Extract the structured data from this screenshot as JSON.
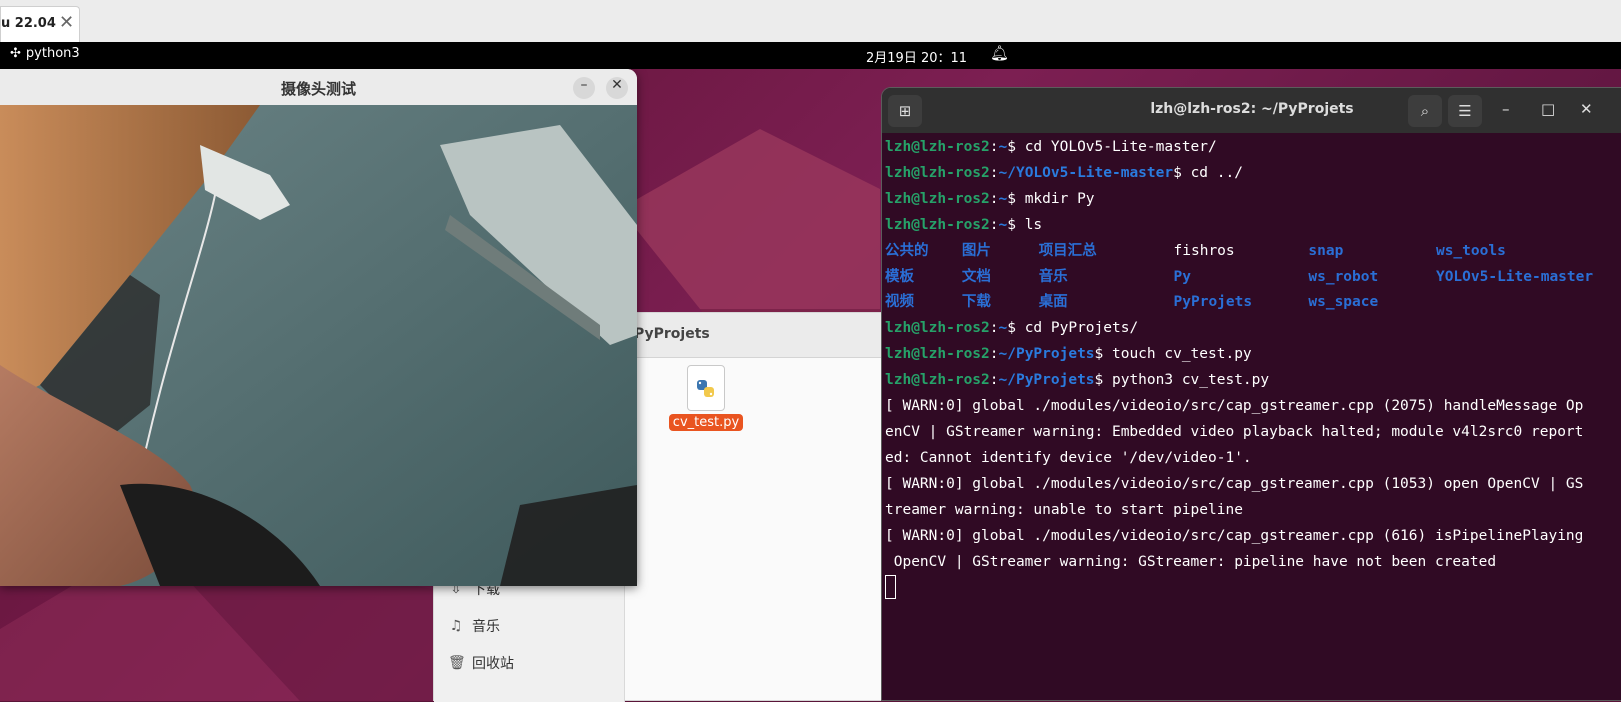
{
  "vm_tab": {
    "label": "u 22.04",
    "close": "✕"
  },
  "topbar": {
    "app_name": "python3",
    "clock": "2月19日 20：11"
  },
  "camera_window": {
    "title": "摄像头测试",
    "min": "–",
    "close": "✕"
  },
  "files_window": {
    "path": "PyProjets",
    "sidebar": [
      {
        "label": "下载",
        "icon": "download-icon"
      },
      {
        "label": "音乐",
        "icon": "music-icon"
      },
      {
        "label": "回收站",
        "icon": "trash-icon"
      }
    ],
    "files": [
      {
        "name": "cv_test.py",
        "icon": "python-file-icon"
      }
    ]
  },
  "terminal": {
    "title": "lzh@lzh-ros2: ~/PyProjets",
    "user_host": "lzh@lzh-ros2",
    "lines": [
      {
        "type": "prompt",
        "path": "~",
        "cmd": " cd YOLOv5-Lite-master/"
      },
      {
        "type": "prompt",
        "path": "~/YOLOv5-Lite-master",
        "cmd": " cd ../"
      },
      {
        "type": "prompt",
        "path": "~",
        "cmd": " mkdir Py"
      },
      {
        "type": "prompt",
        "path": "~",
        "cmd": " ls"
      },
      {
        "type": "ls",
        "cols": [
          {
            "t": "公共的",
            "c": "dir"
          },
          {
            "t": "图片",
            "c": "dir"
          },
          {
            "t": "项目汇总",
            "c": "dir"
          },
          {
            "t": "fishros",
            "c": "file"
          },
          {
            "t": "snap",
            "c": "dir"
          },
          {
            "t": "ws_tools",
            "c": "dir"
          }
        ]
      },
      {
        "type": "ls",
        "cols": [
          {
            "t": "模板",
            "c": "dir"
          },
          {
            "t": "文档",
            "c": "dir"
          },
          {
            "t": "音乐",
            "c": "dir"
          },
          {
            "t": "Py",
            "c": "dir"
          },
          {
            "t": "ws_robot",
            "c": "dir"
          },
          {
            "t": "YOLOv5-Lite-master",
            "c": "dir"
          }
        ]
      },
      {
        "type": "ls",
        "cols": [
          {
            "t": "视频",
            "c": "dir"
          },
          {
            "t": "下载",
            "c": "dir"
          },
          {
            "t": "桌面",
            "c": "dir"
          },
          {
            "t": "PyProjets",
            "c": "dir"
          },
          {
            "t": "ws_space",
            "c": "dir"
          }
        ]
      },
      {
        "type": "prompt",
        "path": "~",
        "cmd": " cd PyProjets/"
      },
      {
        "type": "prompt",
        "path": "~/PyProjets",
        "cmd": " touch cv_test.py"
      },
      {
        "type": "prompt",
        "path": "~/PyProjets",
        "cmd": " python3 cv_test.py"
      },
      {
        "type": "out",
        "text": "[ WARN:0] global ./modules/videoio/src/cap_gstreamer.cpp (2075) handleMessage Op"
      },
      {
        "type": "out",
        "text": "enCV | GStreamer warning: Embedded video playback halted; module v4l2src0 report"
      },
      {
        "type": "out",
        "text": "ed: Cannot identify device '/dev/video-1'."
      },
      {
        "type": "out",
        "text": "[ WARN:0] global ./modules/videoio/src/cap_gstreamer.cpp (1053) open OpenCV | GS"
      },
      {
        "type": "out",
        "text": "treamer warning: unable to start pipeline"
      },
      {
        "type": "out",
        "text": "[ WARN:0] global ./modules/videoio/src/cap_gstreamer.cpp (616) isPipelinePlaying"
      },
      {
        "type": "out",
        "text": " OpenCV | GStreamer warning: GStreamer: pipeline have not been created"
      }
    ]
  },
  "colors": {
    "accent": "#e95420",
    "prompt_user": "#26a269",
    "prompt_path": "#2a7bde",
    "terminal_bg": "#300a24"
  }
}
